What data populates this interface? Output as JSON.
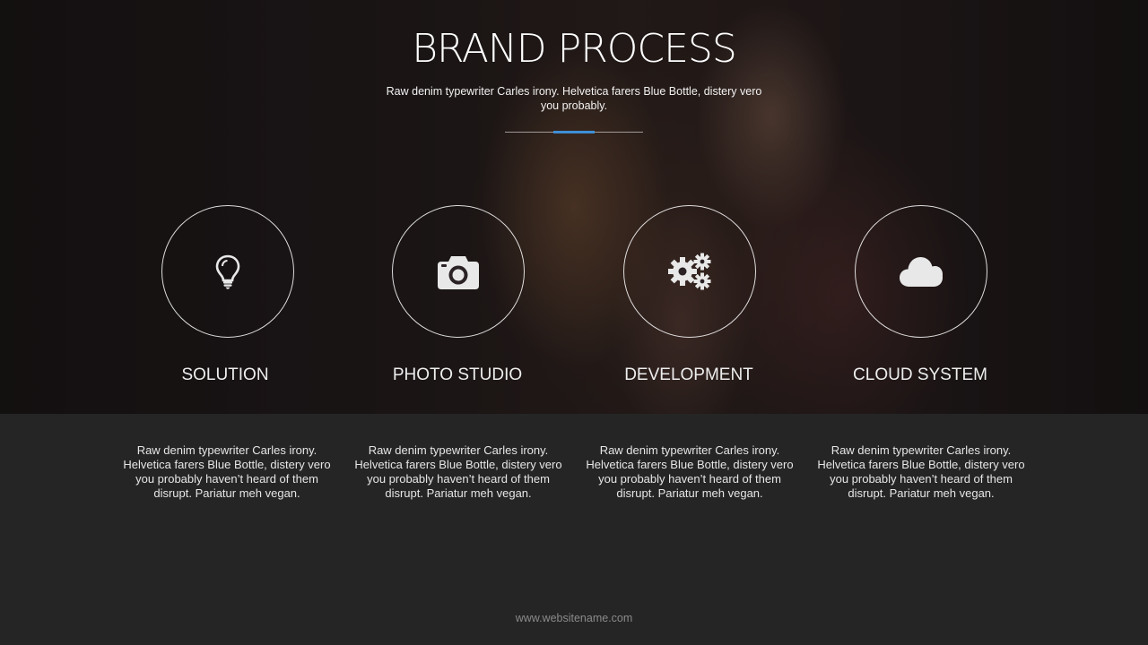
{
  "header": {
    "title": "BRAND PROCESS",
    "subtitle": "Raw denim typewriter Carles irony. Helvetica farers Blue Bottle, distery vero you probably.",
    "accent_color": "#3f8fd6"
  },
  "features": [
    {
      "icon": "lightbulb-icon",
      "label": "SOLUTION",
      "description": "Raw denim typewriter Carles irony. Helvetica farers Blue Bottle, distery vero you probably haven’t heard of them disrupt. Pariatur meh vegan."
    },
    {
      "icon": "camera-icon",
      "label": "PHOTO STUDIO",
      "description": "Raw denim typewriter Carles irony. Helvetica farers Blue Bottle, distery vero you probably haven’t heard of them disrupt. Pariatur meh vegan."
    },
    {
      "icon": "gears-icon",
      "label": "DEVELOPMENT",
      "description": "Raw denim typewriter Carles irony. Helvetica farers Blue Bottle, distery vero you probably haven’t heard of them disrupt. Pariatur meh vegan."
    },
    {
      "icon": "cloud-icon",
      "label": "CLOUD SYSTEM",
      "description": "Raw denim typewriter Carles irony. Helvetica farers Blue Bottle, distery vero you probably haven’t heard of them disrupt. Pariatur meh vegan."
    }
  ],
  "footer": {
    "website": "www.websitename.com"
  }
}
